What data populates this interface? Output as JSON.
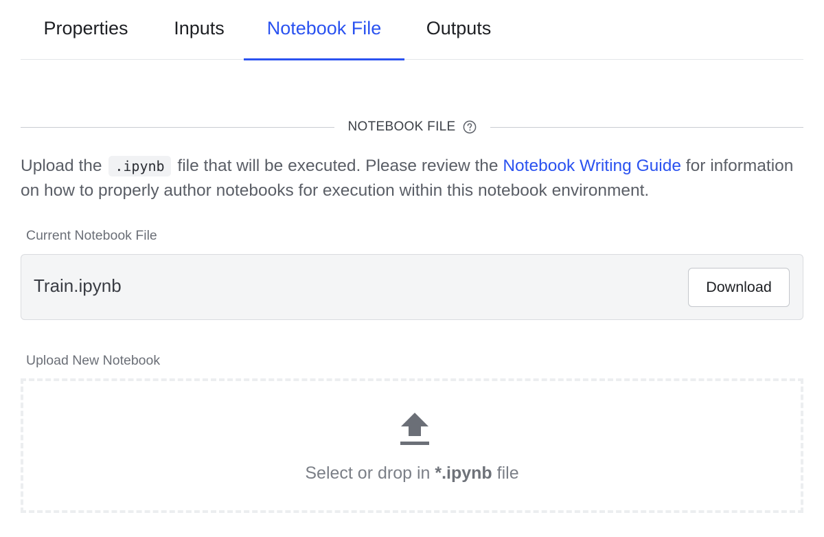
{
  "tabs": [
    {
      "label": "Properties",
      "active": false
    },
    {
      "label": "Inputs",
      "active": false
    },
    {
      "label": "Notebook File",
      "active": true
    },
    {
      "label": "Outputs",
      "active": false
    }
  ],
  "section": {
    "title": "NOTEBOOK FILE",
    "help_icon": "question-circle-icon"
  },
  "description": {
    "part1": "Upload the",
    "code": ".ipynb",
    "part2": "file that will be executed. Please review the",
    "link_text": "Notebook Writing Guide",
    "part3": "for information on how to properly author notebooks for execution within this notebook environment."
  },
  "current_file": {
    "label": "Current Notebook File",
    "file_name": "Train.ipynb",
    "download_label": "Download"
  },
  "upload": {
    "label": "Upload New Notebook",
    "icon": "upload-icon",
    "prompt_prefix": "Select or drop in",
    "prompt_pattern": "*.ipynb",
    "prompt_suffix": "file"
  },
  "colors": {
    "accent": "#2a52f0",
    "text_primary": "#1d1f23",
    "text_secondary": "#5a5e66",
    "border": "#d9dbdf"
  }
}
